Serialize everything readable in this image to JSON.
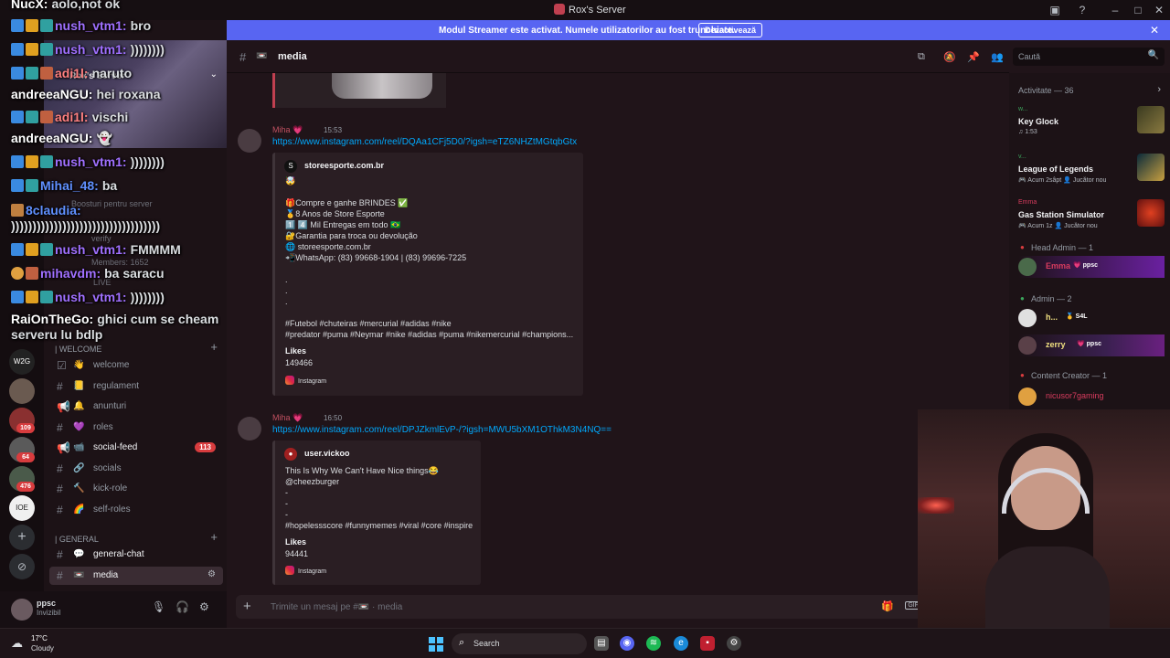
{
  "window": {
    "title": "Rox's Server"
  },
  "banner": {
    "message": "Modul Streamer este activat. Numele utilizatorilor au fost trunchiate.",
    "button": "Dezactivează"
  },
  "server": {
    "name": "Rox's Server",
    "rail_badges": [
      "109",
      "64",
      "476"
    ],
    "faded_items": [
      "Members: 1652",
      "LIVE",
      "Boosturi pentru server",
      "verify"
    ]
  },
  "categories": {
    "welcome": "| WELCOME",
    "general": "| GENERAL"
  },
  "channels": [
    {
      "emoji": "👋",
      "label": "welcome"
    },
    {
      "emoji": "📒",
      "label": "regulament"
    },
    {
      "emoji": "🔔",
      "label": "anunturi"
    },
    {
      "emoji": "💜",
      "label": "roles"
    },
    {
      "emoji": "📹",
      "label": "social-feed",
      "badge": "113"
    },
    {
      "emoji": "🔗",
      "label": "socials"
    },
    {
      "emoji": "🔨",
      "label": "kick-role"
    },
    {
      "emoji": "🌈",
      "label": "self-roles"
    },
    {
      "emoji": "💬",
      "label": "general-chat"
    },
    {
      "emoji": "📼",
      "label": "media"
    }
  ],
  "user": {
    "name": "ppsc",
    "status": "Invizibil"
  },
  "chat": {
    "channel_name": "media",
    "search_placeholder": "Caută",
    "composer_placeholder": "Trimite un mesaj pe #📼 · media",
    "gif_label": "GIF"
  },
  "messages": [
    {
      "author": "Miha 💗",
      "time": "15:53",
      "link": "https://www.instagram.com/reel/DQAa1CFj5D0/?igsh=eTZ6NHZtMGtqbGtx",
      "embed": {
        "provider": "storeesporte.com.br",
        "lines": [
          "🤯",
          "",
          "🎁Compre e ganhe BRINDES ✅",
          "🥇8 Anos de Store Esporte",
          "1️⃣ 4️⃣ Mil Entregas em todo 🇧🇷",
          "🔐Garantia para troca ou devolução",
          "🌐 storeesporte.com.br",
          "📲WhatsApp: (83) 99668-1904 | (83) 99696-7225",
          "",
          ".",
          ".",
          ".",
          "",
          "#Futebol #chuteiras #mercurial #adidas #nike",
          "#predator #puma #Neymar #nike #adidas #puma #nikemercurial #champions..."
        ],
        "likes_label": "Likes",
        "likes": "149466",
        "footer": "Instagram"
      }
    },
    {
      "author": "Miha 💗",
      "time": "16:50",
      "link": "https://www.instagram.com/reel/DPJZkmlEvP-/?igsh=MWU5bXM1OThkM3N4NQ==",
      "embed": {
        "provider": "user.vickoo",
        "lines": [
          "This Is Why We Can't Have Nice things😂",
          "@cheezburger",
          "-",
          "-",
          "-",
          "#hopelessscore #funnymemes #viral #core #inspire"
        ],
        "likes_label": "Likes",
        "likes": "94441",
        "footer": "Instagram"
      }
    }
  ],
  "members": {
    "activity_header": "Activitate — 36",
    "activities": [
      {
        "user": "w...",
        "game": "Key Glock",
        "sub": "♫ 1:53"
      },
      {
        "user": "v...",
        "game": "League of Legends",
        "sub": "🎮 Acum 2sâpt  👤 Jucător nou"
      },
      {
        "user": "Emma",
        "game": "Gas Station Simulator",
        "sub": "🎮 Acum 1z  👤 Jucător nou"
      }
    ],
    "roles": [
      {
        "name": "Head Admin — 1",
        "members": [
          {
            "name": "Emma",
            "tag": "💗 ppsc",
            "color": "#d83c5e"
          }
        ]
      },
      {
        "name": "Admin — 2",
        "members": [
          {
            "name": "h...",
            "tag": "🥇 S4L",
            "color": "#f0e080"
          },
          {
            "name": "zerry",
            "tag": "💗 ppsc",
            "color": "#f0e080"
          }
        ]
      },
      {
        "name": "Content Creator — 1",
        "members": [
          {
            "name": "nicusor7gaming",
            "tag": "",
            "color": "#d83c5e"
          }
        ]
      }
    ]
  },
  "overlay_chat": [
    {
      "user": "NucX:",
      "text": "aolo,not ok",
      "color": "#ffffff"
    },
    {
      "user": "nush_vtm1:",
      "text": "bro",
      "color": "#a070ff"
    },
    {
      "user": "nush_vtm1:",
      "text": "))))))))",
      "color": "#a070ff"
    },
    {
      "user": "adi1l:",
      "text": "naruto",
      "color": "#ff8080"
    },
    {
      "user": "andreeaNGU:",
      "text": "hei roxana",
      "color": "#ffffff"
    },
    {
      "user": "adi1l:",
      "text": "vischi",
      "color": "#ff8080"
    },
    {
      "user": "andreeaNGU:",
      "text": "👻",
      "color": "#ffffff"
    },
    {
      "user": "nush_vtm1:",
      "text": "))))))))",
      "color": "#a070ff"
    },
    {
      "user": "Mihai_48:",
      "text": "ba",
      "color": "#6090ff"
    },
    {
      "user": "8claudia:",
      "text": ")))))))))))))))))))))))))))))))))))",
      "color": "#6090ff"
    },
    {
      "user": "nush_vtm1:",
      "text": "FMMMM",
      "color": "#a070ff"
    },
    {
      "user": "mihavdm:",
      "text": "ba saracu",
      "color": "#a070ff"
    },
    {
      "user": "nush_vtm1:",
      "text": "))))))))",
      "color": "#a070ff"
    },
    {
      "user": "RaiOnTheGo:",
      "text": "ghici cum se cheam",
      "color": "#ffffff"
    },
    {
      "user": "",
      "text": "serveru lu bdlp",
      "color": "#ffffff"
    }
  ],
  "taskbar": {
    "temp": "17°C",
    "condition": "Cloudy",
    "search": "Search"
  },
  "icons": {
    "theme_accent": "#5865f2",
    "link_color": "#00a8fc"
  }
}
